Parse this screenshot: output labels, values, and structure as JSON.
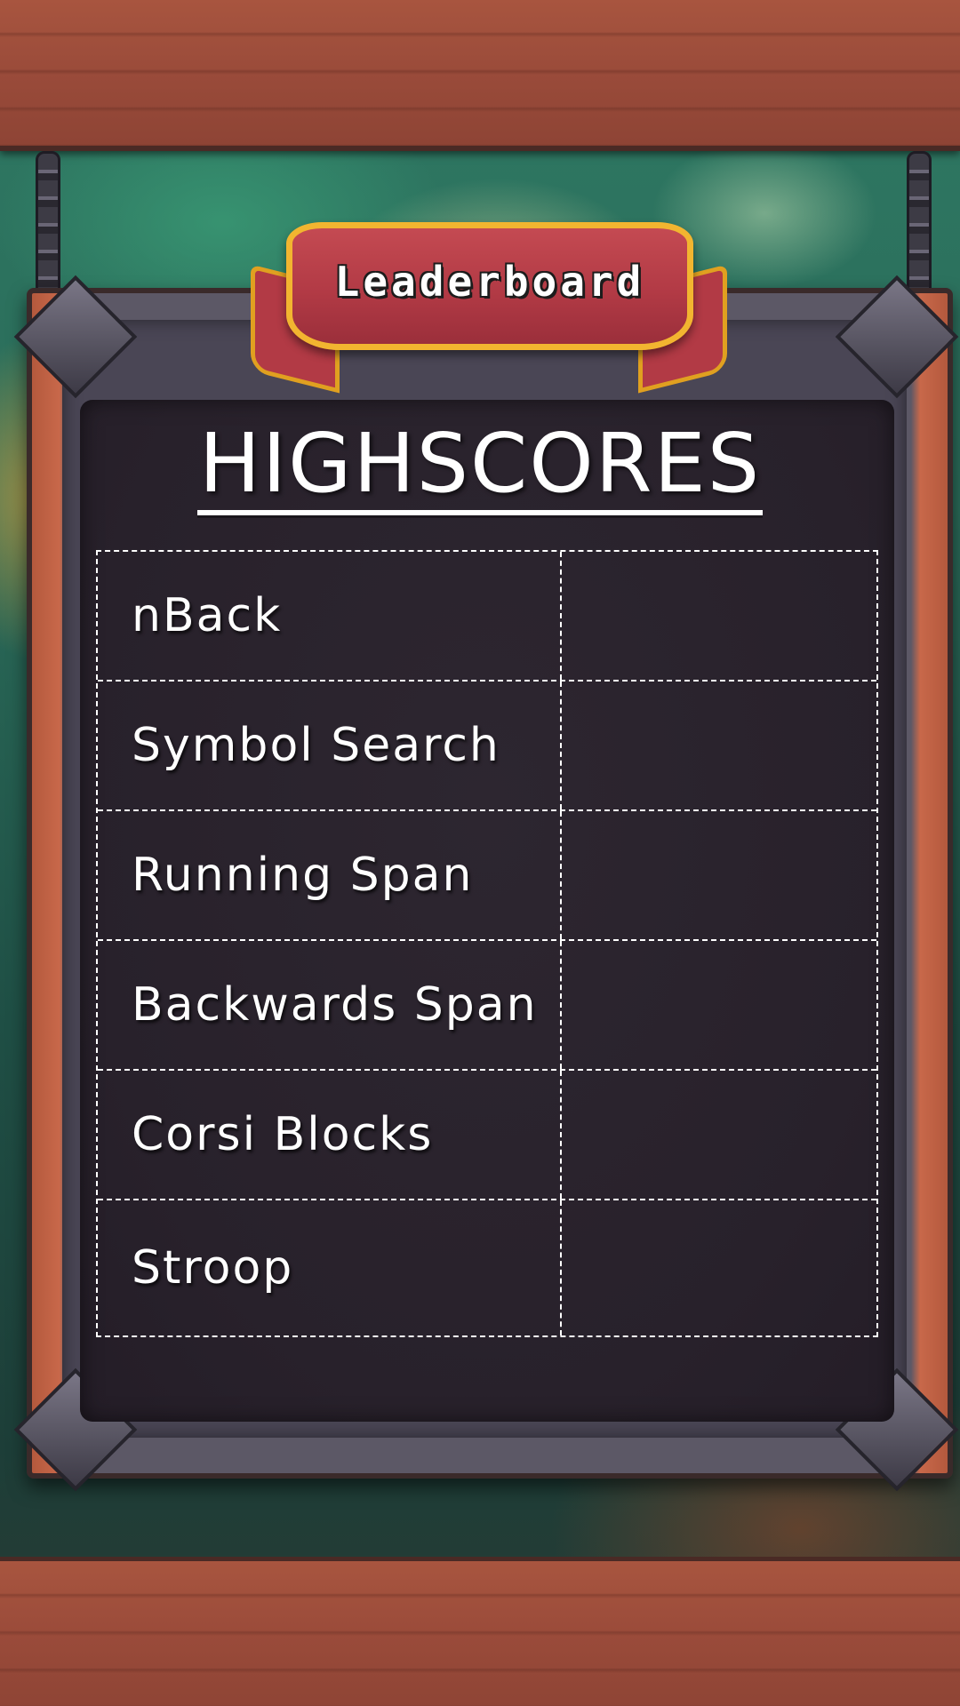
{
  "banner": {
    "title": "Leaderboard"
  },
  "board": {
    "heading": "HIGHSCORES",
    "rows": [
      {
        "game": "nBack",
        "score": ""
      },
      {
        "game": "Symbol Search",
        "score": ""
      },
      {
        "game": "Running Span",
        "score": ""
      },
      {
        "game": "Backwards Span",
        "score": ""
      },
      {
        "game": "Corsi Blocks",
        "score": ""
      },
      {
        "game": "Stroop",
        "score": ""
      }
    ]
  },
  "colors": {
    "wood": "#9a4b3a",
    "banner_red": "#b23a45",
    "banner_gold": "#f2b530",
    "chalkboard": "#28212b",
    "chalk": "#ffffff"
  }
}
